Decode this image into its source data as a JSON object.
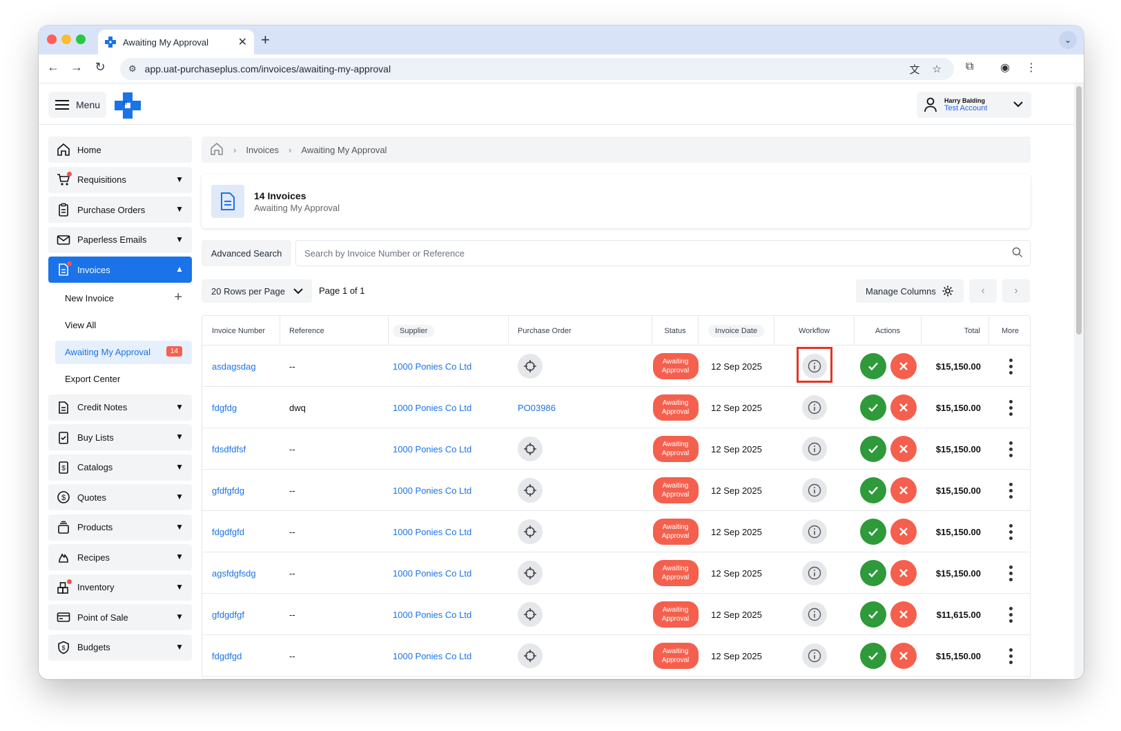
{
  "browser": {
    "tab_title": "Awaiting My Approval",
    "url": "app.uat-purchaseplus.com/invoices/awaiting-my-approval"
  },
  "topbar": {
    "menu_label": "Menu",
    "user_name": "Harry Balding",
    "user_account": "Test Account"
  },
  "sidebar": {
    "items": [
      {
        "label": "Home"
      },
      {
        "label": "Requisitions"
      },
      {
        "label": "Purchase Orders"
      },
      {
        "label": "Paperless Emails"
      },
      {
        "label": "Invoices"
      },
      {
        "label": "Credit Notes"
      },
      {
        "label": "Buy Lists"
      },
      {
        "label": "Catalogs"
      },
      {
        "label": "Quotes"
      },
      {
        "label": "Products"
      },
      {
        "label": "Recipes"
      },
      {
        "label": "Inventory"
      },
      {
        "label": "Point of Sale"
      },
      {
        "label": "Budgets"
      }
    ],
    "sub": {
      "new_invoice": "New Invoice",
      "view_all": "View All",
      "awaiting": "Awaiting My Approval",
      "awaiting_count": "14",
      "export": "Export Center"
    }
  },
  "breadcrumb": {
    "invoices": "Invoices",
    "current": "Awaiting My Approval"
  },
  "header": {
    "title": "14 Invoices",
    "subtitle": "Awaiting My Approval"
  },
  "toolbar": {
    "advanced_search": "Advanced Search",
    "search_placeholder": "Search by Invoice Number or Reference",
    "rows_per_page": "20 Rows per Page",
    "page_info": "Page 1 of 1",
    "manage_columns": "Manage Columns"
  },
  "table": {
    "columns": {
      "invoice_number": "Invoice Number",
      "reference": "Reference",
      "supplier": "Supplier",
      "purchase_order": "Purchase Order",
      "status": "Status",
      "invoice_date": "Invoice Date",
      "workflow": "Workflow",
      "actions": "Actions",
      "total": "Total",
      "more": "More"
    },
    "status_line1": "Awaiting",
    "status_line2": "Approval",
    "rows": [
      {
        "invoice": "asdagsdag",
        "reference": "--",
        "supplier": "1000 Ponies Co Ltd",
        "po": "",
        "date": "12 Sep 2025",
        "total": "$15,150.00"
      },
      {
        "invoice": "fdgfdg",
        "reference": "dwq",
        "supplier": "1000 Ponies Co Ltd",
        "po": "PO03986",
        "date": "12 Sep 2025",
        "total": "$15,150.00"
      },
      {
        "invoice": "fdsdfdfsf",
        "reference": "--",
        "supplier": "1000 Ponies Co Ltd",
        "po": "",
        "date": "12 Sep 2025",
        "total": "$15,150.00"
      },
      {
        "invoice": "gfdfgfdg",
        "reference": "--",
        "supplier": "1000 Ponies Co Ltd",
        "po": "",
        "date": "12 Sep 2025",
        "total": "$15,150.00"
      },
      {
        "invoice": "fdgdfgfd",
        "reference": "--",
        "supplier": "1000 Ponies Co Ltd",
        "po": "",
        "date": "12 Sep 2025",
        "total": "$15,150.00"
      },
      {
        "invoice": "agsfdgfsdg",
        "reference": "--",
        "supplier": "1000 Ponies Co Ltd",
        "po": "",
        "date": "12 Sep 2025",
        "total": "$15,150.00"
      },
      {
        "invoice": "gfdgdfgf",
        "reference": "--",
        "supplier": "1000 Ponies Co Ltd",
        "po": "",
        "date": "12 Sep 2025",
        "total": "$11,615.00"
      },
      {
        "invoice": "fdgdfgd",
        "reference": "--",
        "supplier": "1000 Ponies Co Ltd",
        "po": "",
        "date": "12 Sep 2025",
        "total": "$15,150.00"
      }
    ]
  },
  "colors": {
    "accent": "#1a73e8",
    "status": "#f4604d",
    "approve": "#2e9a3a",
    "highlight": "#e53322"
  }
}
